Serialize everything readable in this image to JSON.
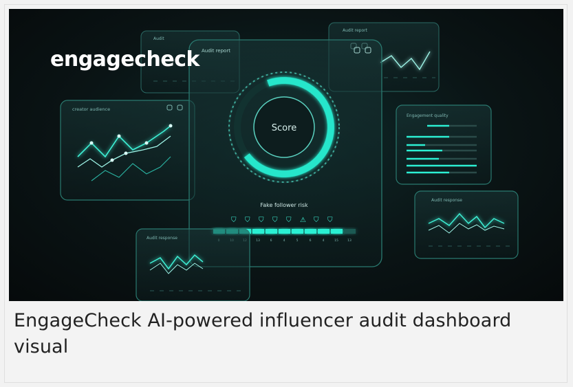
{
  "logo": {
    "text": "engagecheck"
  },
  "caption": "EngageCheck AI-powered influencer audit dashboard visual",
  "panels": {
    "top_left": "Audit",
    "top_right": "Audit report",
    "left": "creator audience",
    "center": "Audit report",
    "right": "Engagement quality",
    "bottom_right": "Audit response",
    "bottom_left": "Audit response"
  },
  "gauge": {
    "label": "Score"
  },
  "fake_follower": {
    "title": "Fake follower risk",
    "ticks": [
      "0",
      "10",
      "12",
      "13",
      "6",
      "4",
      "5",
      "6",
      "4",
      "15",
      "13"
    ]
  },
  "colors": {
    "accent": "#1fe3c8",
    "background": "#0a1415"
  }
}
